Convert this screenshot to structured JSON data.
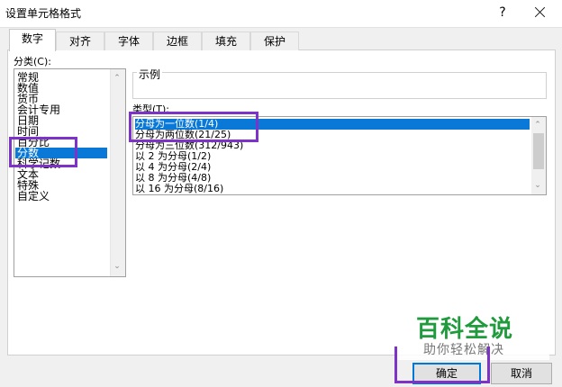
{
  "window": {
    "title": "设置单元格格式",
    "help_label": "?"
  },
  "tabs": [
    {
      "label": "数字",
      "active": true
    },
    {
      "label": "对齐",
      "active": false
    },
    {
      "label": "字体",
      "active": false
    },
    {
      "label": "边框",
      "active": false
    },
    {
      "label": "填充",
      "active": false
    },
    {
      "label": "保护",
      "active": false
    }
  ],
  "category": {
    "label": "分类(C):",
    "items": [
      "常规",
      "数值",
      "货币",
      "会计专用",
      "日期",
      "时间",
      "百分比",
      "分数",
      "科学记数",
      "文本",
      "特殊",
      "自定义"
    ],
    "selected_index": 7
  },
  "sample": {
    "label": "示例"
  },
  "type": {
    "label": "类型(T):",
    "items": [
      "分母为一位数(1/4)",
      "分母为两位数(21/25)",
      "分母为三位数(312/943)",
      "以 2 为分母(1/2)",
      "以 4 为分母(2/4)",
      "以 8 为分母(4/8)",
      "以 16 为分母(8/16)"
    ],
    "selected_index": 0
  },
  "buttons": {
    "ok": "确定",
    "cancel": "取消"
  },
  "watermark": {
    "logo": "百科全说",
    "tagline": "助你轻松解决"
  },
  "colors": {
    "selection": "#0a78d7",
    "highlight_box": "#7d32c8",
    "watermark_green": "#1f9a3c"
  }
}
